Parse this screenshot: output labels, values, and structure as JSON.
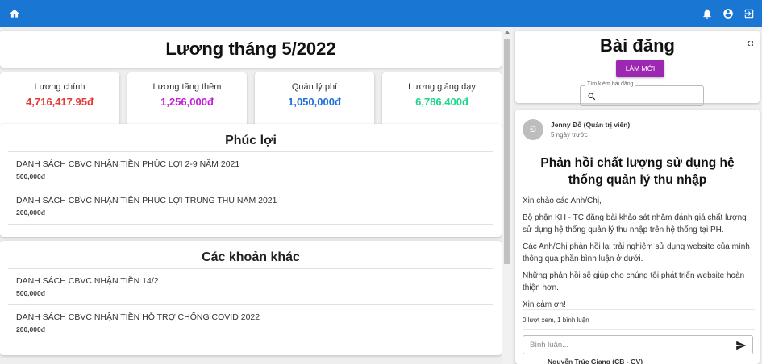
{
  "appbar": {
    "home_icon": "home-icon",
    "bell_icon": "bell-icon",
    "account_icon": "account-circle-icon",
    "logout_icon": "logout-icon",
    "color": "#1976d2"
  },
  "main": {
    "title": "Lương tháng 5/2022",
    "stats": [
      {
        "label": "Lương chính",
        "value": "4,716,417.95đ",
        "color": "#e53935"
      },
      {
        "label": "Lương tăng thêm",
        "value": "1,256,000đ",
        "color": "#c21fd6"
      },
      {
        "label": "Quản lý phí",
        "value": "1,050,000đ",
        "color": "#1e6fd9"
      },
      {
        "label": "Lương giảng dạy",
        "value": "6,786,400đ",
        "color": "#1cd68a"
      }
    ],
    "welfare": {
      "heading": "Phúc lợi",
      "items": [
        {
          "title": "DANH SÁCH CBVC NHẬN TIỀN PHÚC LỢI 2-9 NĂM 2021",
          "amount": "500,000đ"
        },
        {
          "title": "DANH SÁCH CBVC NHẬN TIỀN PHÚC LỢI TRUNG THU NĂM 2021",
          "amount": "200,000đ"
        }
      ]
    },
    "other": {
      "heading": "Các khoản khác",
      "items": [
        {
          "title": "DANH SÁCH CBVC NHẬN TIỀN 14/2",
          "amount": "500,000đ"
        },
        {
          "title": "DANH SÁCH CBVC NHẬN TIỀN HỖ TRỢ CHỐNG COVID 2022",
          "amount": "200,000đ"
        }
      ]
    }
  },
  "posts": {
    "heading": "Bài đăng",
    "new_button": "LÀM MỚI",
    "new_button_color": "#9c27b0",
    "search_label": "Tìm kiếm bài đăng",
    "post": {
      "avatar_letter": "Đ",
      "author": "Jenny Đỗ (Quản trị viên)",
      "time": "5 ngày trước",
      "title": "Phản hồi chất lượng sử dụng hệ thống quản lý thu nhập",
      "paragraphs": [
        "Xin chào các Anh/Chị,",
        "Bộ phận KH - TC đăng bài khảo sát nhằm đánh giá chất lượng sử dụng hệ thống quản lý thu nhập trên hệ thống tại PH.",
        "Các Anh/Chị phản hồi lại trải nghiệm sử dụng website của mình thông qua phần bình luận ở dưới.",
        "Những phản hồi sẽ giúp cho chúng tôi phát triển website hoàn thiện hơn.",
        "Xin cảm ơn!"
      ],
      "stats": "0 lượt xem, 1 bình luận",
      "comment_placeholder": "Bình luận...",
      "next_author": "Nguyễn Trúc Giang (CB - GV)"
    }
  }
}
